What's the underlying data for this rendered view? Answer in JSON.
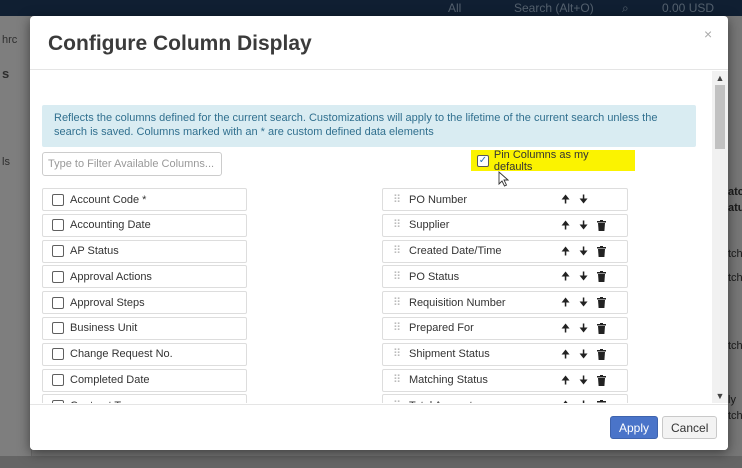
{
  "background": {
    "topbar_left": "",
    "topbar_all": "All",
    "topbar_search": "Search (Alt+O)",
    "topbar_amount": "0.00 USD",
    "left_snips": [
      "hrc",
      "s",
      "ls"
    ],
    "right_snips": [
      "atcl",
      "atus",
      "tch",
      "tch",
      "tch",
      "ly",
      "tch"
    ]
  },
  "modal": {
    "title": "Configure Column Display",
    "info_text": "Reflects the columns defined for the current search. Customizations will apply to the lifetime of the current search unless the search is saved. Columns marked with an * are custom defined data elements",
    "filter_placeholder": "Type to Filter Available Columns...",
    "pin_label": "Pin Columns as my defaults",
    "pin_checked": true,
    "available_columns": [
      "Account Code *",
      "Accounting Date",
      "AP Status",
      "Approval Actions",
      "Approval Steps",
      "Business Unit",
      "Change Request No.",
      "Completed Date",
      "Contract Type"
    ],
    "selected_columns": [
      {
        "label": "PO Number",
        "up": "🠉",
        "down": "🠋",
        "delete": false
      },
      {
        "label": "Supplier",
        "up": "🠉",
        "down": "🠋",
        "delete": true
      },
      {
        "label": "Created Date/Time",
        "up": "🠉",
        "down": "🠋",
        "delete": true
      },
      {
        "label": "PO Status",
        "up": "🠉",
        "down": "🠋",
        "delete": true
      },
      {
        "label": "Requisition Number",
        "up": "🠉",
        "down": "🠋",
        "delete": true
      },
      {
        "label": "Prepared For",
        "up": "🠉",
        "down": "🠋",
        "delete": true
      },
      {
        "label": "Shipment Status",
        "up": "🠉",
        "down": "🠋",
        "delete": true
      },
      {
        "label": "Matching Status",
        "up": "🠉",
        "down": "🠋",
        "delete": true
      },
      {
        "label": "Total Amount",
        "up": "🠉",
        "down": "🠋",
        "delete": true
      }
    ],
    "apply_label": "Apply",
    "cancel_label": "Cancel",
    "close_symbol": "×"
  },
  "colors": {
    "accent": "#4a74c9",
    "info_bg": "#d9ecf2",
    "info_text": "#31708f",
    "highlight": "#fbf300"
  }
}
